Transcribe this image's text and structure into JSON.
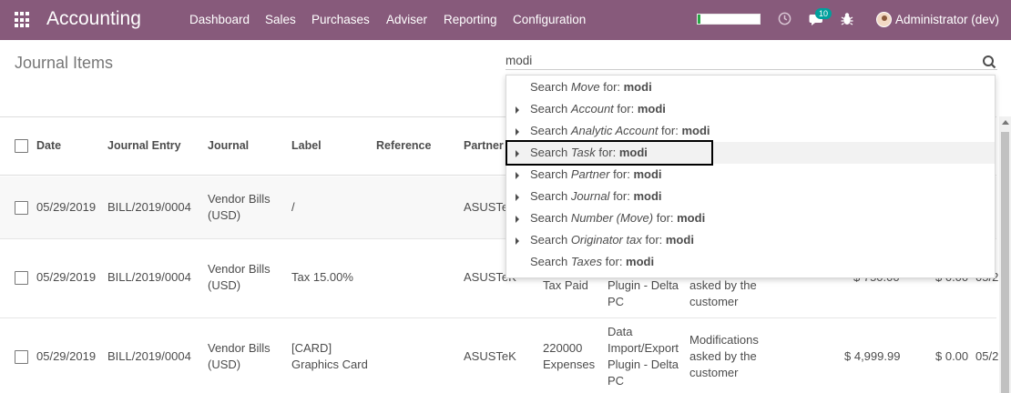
{
  "navbar": {
    "brand": "Accounting",
    "menu": [
      "Dashboard",
      "Sales",
      "Purchases",
      "Adviser",
      "Reporting",
      "Configuration"
    ],
    "progress": 0.05,
    "messages_badge": "10",
    "user": "Administrator (dev)"
  },
  "control": {
    "breadcrumb": "Journal Items",
    "search_value": "modi"
  },
  "table": {
    "headers": [
      "Date",
      "Journal Entry",
      "Journal",
      "Label",
      "Reference",
      "Partner"
    ],
    "rows": [
      {
        "date": "05/29/2019",
        "entry": "BILL/2019/0004",
        "journal": [
          "Vendor Bills",
          "(USD)"
        ],
        "label": [
          "/"
        ],
        "partner": "ASUSTe"
      },
      {
        "date": "05/29/2019",
        "entry": "BILL/2019/0004",
        "journal": [
          "Vendor Bills",
          "(USD)"
        ],
        "label": [
          "Tax 15.00%"
        ],
        "partner": "ASUSTeK",
        "account": [
          "Tax Paid"
        ],
        "analytic": [
          "Plugin - Delta",
          "PC"
        ],
        "task": [
          "asked by the",
          "customer"
        ],
        "debit": "$ 750.00",
        "credit": "$ 0.00",
        "due": "05/2"
      },
      {
        "date": "05/29/2019",
        "entry": "BILL/2019/0004",
        "journal": [
          "Vendor Bills",
          "(USD)"
        ],
        "label": [
          "[CARD]",
          "Graphics Card"
        ],
        "partner": "ASUSTeK",
        "account": [
          "220000",
          "Expenses"
        ],
        "analytic": [
          "Data",
          "Import/Export",
          "Plugin - Delta",
          "PC"
        ],
        "task": [
          "Modifications",
          "asked by the",
          "customer"
        ],
        "debit": "$ 4,999.99",
        "credit": "$ 0.00",
        "due": "05/2"
      }
    ]
  },
  "autocomplete": {
    "items": [
      {
        "prefix": "Search ",
        "field": "Move",
        "suffix": " for: ",
        "term": "modi",
        "expandable": false
      },
      {
        "prefix": "Search ",
        "field": "Account",
        "suffix": " for: ",
        "term": "modi",
        "expandable": true
      },
      {
        "prefix": "Search ",
        "field": "Analytic Account",
        "suffix": " for: ",
        "term": "modi",
        "expandable": true
      },
      {
        "prefix": "Search ",
        "field": "Task",
        "suffix": " for: ",
        "term": "modi",
        "expandable": true
      },
      {
        "prefix": "Search ",
        "field": "Partner",
        "suffix": " for: ",
        "term": "modi",
        "expandable": true
      },
      {
        "prefix": "Search ",
        "field": "Journal",
        "suffix": " for: ",
        "term": "modi",
        "expandable": true
      },
      {
        "prefix": "Search ",
        "field": "Number (Move)",
        "suffix": " for: ",
        "term": "modi",
        "expandable": true
      },
      {
        "prefix": "Search ",
        "field": "Originator tax",
        "suffix": " for: ",
        "term": "modi",
        "expandable": true
      },
      {
        "prefix": "Search ",
        "field": "Taxes",
        "suffix": " for: ",
        "term": "modi",
        "expandable": false
      }
    ],
    "highlighted_index": 3
  }
}
